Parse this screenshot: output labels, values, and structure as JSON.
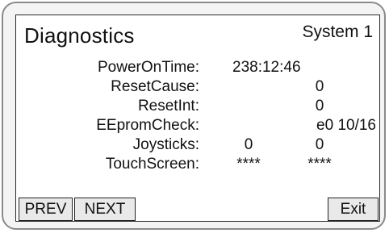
{
  "header": {
    "title": "Diagnostics",
    "system": "System 1"
  },
  "rows": [
    {
      "label": "PowerOnTime:",
      "value": "238:12:46"
    },
    {
      "label": "ResetCause:",
      "value": "0"
    },
    {
      "label": "ResetInt:",
      "value": "0"
    },
    {
      "label": "EEpromCheck:",
      "value": "e0 10/16"
    },
    {
      "label": "Joysticks:",
      "value_a": "0",
      "value_b": "0"
    },
    {
      "label": "TouchScreen:",
      "value_a": "****",
      "value_b": "****"
    }
  ],
  "buttons": {
    "prev": "PREV",
    "next": "NEXT",
    "exit": "Exit"
  }
}
